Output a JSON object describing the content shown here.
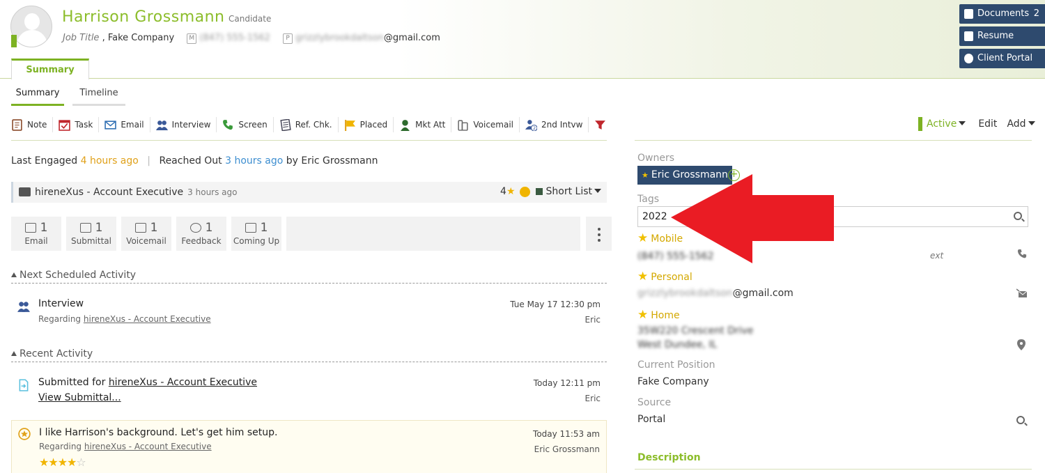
{
  "candidate": {
    "name": "Harrison Grossmann",
    "type": "Candidate",
    "job_title": "Job Title",
    "company": "Fake Company",
    "mobile_badge": "M",
    "mobile": "(847) 555-1562",
    "personal_badge": "P",
    "email_blur": "grizzlybrookdaltson",
    "email_domain": "@gmail.com"
  },
  "header_buttons": {
    "documents": "Documents",
    "documents_count": "2",
    "resume": "Resume",
    "client_portal": "Client Portal"
  },
  "tabs": {
    "main": "Summary",
    "sub": [
      "Summary",
      "Timeline"
    ]
  },
  "toolbar": [
    "Note",
    "Task",
    "Email",
    "Interview",
    "Screen",
    "Ref. Chk.",
    "Placed",
    "Mkt Att",
    "Voicemail",
    "2nd Intvw"
  ],
  "status": {
    "label": "Active",
    "edit": "Edit",
    "add": "Add"
  },
  "engagement": {
    "last_engaged_label": "Last Engaged",
    "last_engaged_value": "4 hours ago",
    "reached_out_label": "Reached Out",
    "reached_out_value": "3 hours ago",
    "reached_out_by": "by Eric Grossmann"
  },
  "job": {
    "title": "hireneXus - Account Executive",
    "ago": "3 hours ago",
    "rating": "4",
    "list": "Short List"
  },
  "stats": [
    {
      "count": "1",
      "label": "Email"
    },
    {
      "count": "1",
      "label": "Submittal"
    },
    {
      "count": "1",
      "label": "Voicemail"
    },
    {
      "count": "1",
      "label": "Feedback"
    },
    {
      "count": "1",
      "label": "Coming Up"
    }
  ],
  "sections": {
    "next": "Next Scheduled Activity",
    "recent": "Recent Activity"
  },
  "next_activity": {
    "title": "Interview",
    "regarding_label": "Regarding",
    "regarding": "hireneXus - Account Executive",
    "date": "Tue May 17 12:30 pm",
    "by": "Eric"
  },
  "recent": [
    {
      "title_prefix": "Submitted for",
      "title_link": "hireneXus - Account Executive",
      "sub_link": "View Submittal...",
      "date": "Today 12:11 pm",
      "by": "Eric"
    },
    {
      "title": "I like Harrison's background.  Let's get him setup.",
      "regarding_label": "Regarding",
      "regarding": "hireneXus - Account Executive",
      "date": "Today 11:53 am",
      "by": "Eric Grossmann",
      "stars": 4,
      "stars_max": 5
    }
  ],
  "right_panel": {
    "owners_label": "Owners",
    "owner": "Eric Grossmann",
    "tags_label": "Tags",
    "tags_value": "2022",
    "mobile_label": "Mobile",
    "mobile_value": "(847) 555-1562",
    "ext_label": "ext",
    "personal_label": "Personal",
    "personal_email_blur": "grizzlybrookdaltson",
    "personal_email_domain": "@gmail.com",
    "home_label": "Home",
    "home_line1": "35W220 Crescent Drive",
    "home_line2": "West Dundee, IL",
    "current_position_label": "Current Position",
    "current_position": "Fake Company",
    "source_label": "Source",
    "source": "Portal",
    "description_label": "Description"
  },
  "colors": {
    "brand_green": "#7db223",
    "navy": "#2e4a6e",
    "orange": "#e0a11a",
    "link_blue": "#3d8ed0",
    "star_gold": "#f0b400",
    "arrow_red": "#ea1c24"
  }
}
